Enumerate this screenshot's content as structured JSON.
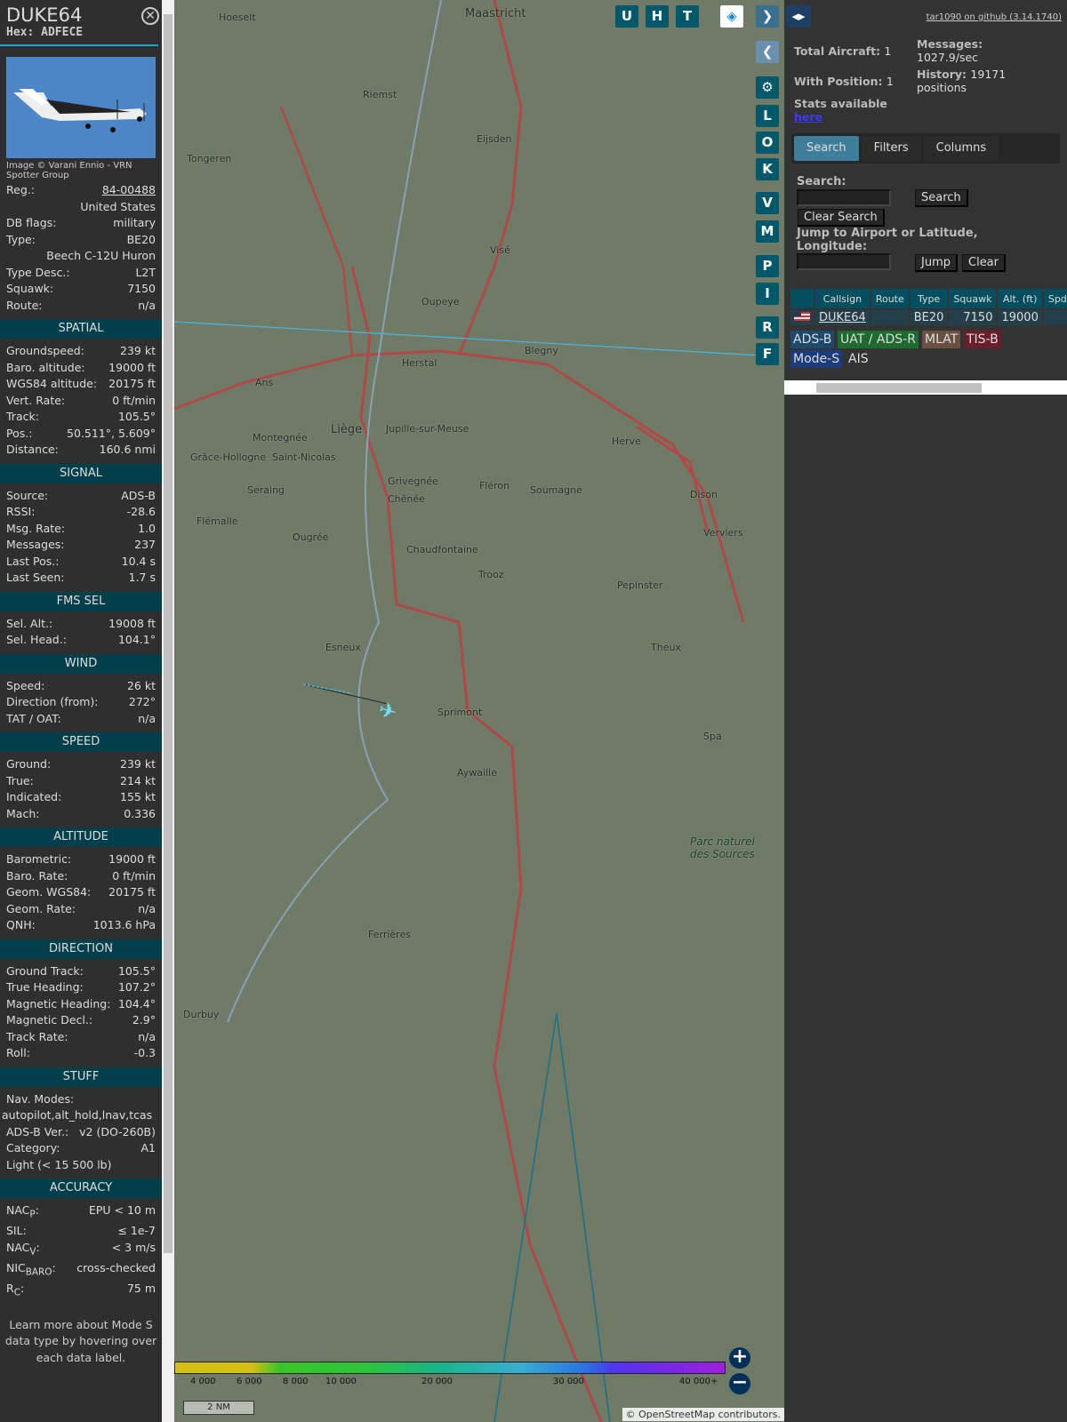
{
  "aircraft": {
    "callsign": "DUKE64",
    "hex_label": "Hex:",
    "hex": "ADFECE",
    "image_credit": "Image © Varani Ennio - VRN Spotter Group",
    "info": [
      {
        "label": "Reg.:",
        "value": "84-00488",
        "link": true
      },
      {
        "label": "",
        "value": "United States"
      },
      {
        "label": "DB flags:",
        "value": "military"
      },
      {
        "label": "Type:",
        "value": "BE20"
      },
      {
        "label": "",
        "value": "Beech C-12U Huron"
      },
      {
        "label": "Type Desc.:",
        "value": "L2T"
      },
      {
        "label": "Squawk:",
        "value": "7150"
      },
      {
        "label": "Route:",
        "value": "n/a"
      }
    ]
  },
  "sections": [
    {
      "title": "SPATIAL",
      "rows": [
        {
          "label": "Groundspeed:",
          "value": "239 kt"
        },
        {
          "label": "Baro. altitude:",
          "value": "19000 ft"
        },
        {
          "label": "WGS84 altitude:",
          "value": "20175 ft"
        },
        {
          "label": "Vert. Rate:",
          "value": "0 ft/min"
        },
        {
          "label": "Track:",
          "value": "105.5°"
        },
        {
          "label": "Pos.:",
          "value": "50.511°, 5.609°"
        },
        {
          "label": "Distance:",
          "value": "160.6 nmi"
        }
      ]
    },
    {
      "title": "SIGNAL",
      "rows": [
        {
          "label": "Source:",
          "value": "ADS-B"
        },
        {
          "label": "RSSI:",
          "value": "-28.6"
        },
        {
          "label": "Msg. Rate:",
          "value": "1.0"
        },
        {
          "label": "Messages:",
          "value": "237"
        },
        {
          "label": "Last Pos.:",
          "value": "10.4 s"
        },
        {
          "label": "Last Seen:",
          "value": "1.7 s"
        }
      ]
    },
    {
      "title": "FMS SEL",
      "rows": [
        {
          "label": "Sel. Alt.:",
          "value": "19008 ft"
        },
        {
          "label": "Sel. Head.:",
          "value": "104.1°"
        }
      ]
    },
    {
      "title": "WIND",
      "rows": [
        {
          "label": "Speed:",
          "value": "26 kt"
        },
        {
          "label": "Direction (from):",
          "value": "272°"
        },
        {
          "label": "TAT / OAT:",
          "value": "n/a"
        }
      ]
    },
    {
      "title": "SPEED",
      "rows": [
        {
          "label": "Ground:",
          "value": "239 kt"
        },
        {
          "label": "True:",
          "value": "214 kt"
        },
        {
          "label": "Indicated:",
          "value": "155 kt"
        },
        {
          "label": "Mach:",
          "value": "0.336"
        }
      ]
    },
    {
      "title": "ALTITUDE",
      "rows": [
        {
          "label": "Barometric:",
          "value": "19000 ft"
        },
        {
          "label": "Baro. Rate:",
          "value": "0 ft/min"
        },
        {
          "label": "Geom. WGS84:",
          "value": "20175 ft"
        },
        {
          "label": "Geom. Rate:",
          "value": "n/a"
        },
        {
          "label": "QNH:",
          "value": "1013.6 hPa"
        }
      ]
    },
    {
      "title": "DIRECTION",
      "rows": [
        {
          "label": "Ground Track:",
          "value": "105.5°"
        },
        {
          "label": "True Heading:",
          "value": "107.2°"
        },
        {
          "label": "Magnetic Heading:",
          "value": "104.4°"
        },
        {
          "label": "Magnetic Decl.:",
          "value": "2.9°"
        },
        {
          "label": "Track Rate:",
          "value": "n/a"
        },
        {
          "label": "Roll:",
          "value": "-0.3"
        }
      ]
    },
    {
      "title": "STUFF",
      "rows": [
        {
          "label": "Nav. Modes:",
          "value": ""
        },
        {
          "label": "",
          "value": "autopilot,alt_hold,lnav,tcas"
        },
        {
          "label": "ADS-B Ver.:",
          "value": "v2 (DO-260B)"
        },
        {
          "label": "Category:",
          "value": "A1"
        },
        {
          "label": "Light (< 15 500 lb)",
          "value": ""
        }
      ]
    },
    {
      "title": "ACCURACY",
      "rows": [
        {
          "label": "NACP:",
          "value": "EPU < 10 m"
        },
        {
          "label": "SIL:",
          "value": "≤ 1e-7"
        },
        {
          "label": "NACV:",
          "value": "< 3 m/s"
        },
        {
          "label": "NICBARO:",
          "value": "cross-checked"
        },
        {
          "label": "RC:",
          "value": "75 m"
        }
      ]
    }
  ],
  "note": "Learn more about Mode S data type by hovering over each data label.",
  "map": {
    "buttons": [
      "U",
      "H",
      "T",
      "L",
      "O",
      "K",
      "V",
      "M",
      "P",
      "I",
      "R",
      "F"
    ],
    "places": [
      "Maastricht",
      "Hoeselt",
      "Riemst",
      "Tongeren",
      "Eijsden",
      "Visé",
      "Oupeye",
      "Blegny",
      "Herstal",
      "Ans",
      "Liège",
      "Jupille-sur-Meuse",
      "Montegnée",
      "Saint-Nicolas",
      "Grâce-Hollogne",
      "Seraing",
      "Grivegnée",
      "Chênée",
      "Fléron",
      "Soumagne",
      "Herve",
      "Dison",
      "Verviers",
      "Flémalle",
      "Ougrée",
      "Chaudfontaine",
      "Trooz",
      "Pepinster",
      "Theux",
      "Esneux",
      "Sprimont",
      "Spa",
      "Aywaille",
      "Parc naturel des Sources",
      "Ferrières",
      "Durbuy"
    ],
    "legend": [
      "4 000",
      "6 000",
      "8 000",
      "10 000",
      "20 000",
      "30 000",
      "40 000+"
    ],
    "scale": "2 NM",
    "attribution": "© OpenStreetMap contributors."
  },
  "right": {
    "github": "tar1090 on github (3.14.1740)",
    "total_label": "Total Aircraft:",
    "total": "1",
    "withpos_label": "With Position:",
    "withpos": "1",
    "messages_label": "Messages:",
    "messages": "1027.9/sec",
    "history_label": "History:",
    "history": "19171 positions",
    "stats_label": "Stats available",
    "stats_link": "here",
    "tabs": [
      "Search",
      "Filters",
      "Columns"
    ],
    "search_label": "Search:",
    "search_btn": "Search",
    "clear_search": "Clear Search",
    "jump_label": "Jump to Airport or Latitude, Longitude:",
    "jump_btn": "Jump",
    "clear_btn": "Clear",
    "columns": [
      "",
      "Callsign",
      "Route",
      "Type",
      "Squawk",
      "Alt. (ft)",
      "Spd."
    ],
    "row": {
      "callsign": "DUKE64",
      "route": "",
      "type": "BE20",
      "squawk": "7150",
      "alt": "19000",
      "spd": ""
    },
    "badges": [
      "ADS-B",
      "UAT / ADS-R",
      "MLAT",
      "TIS-B",
      "Mode-S",
      "AIS"
    ]
  }
}
